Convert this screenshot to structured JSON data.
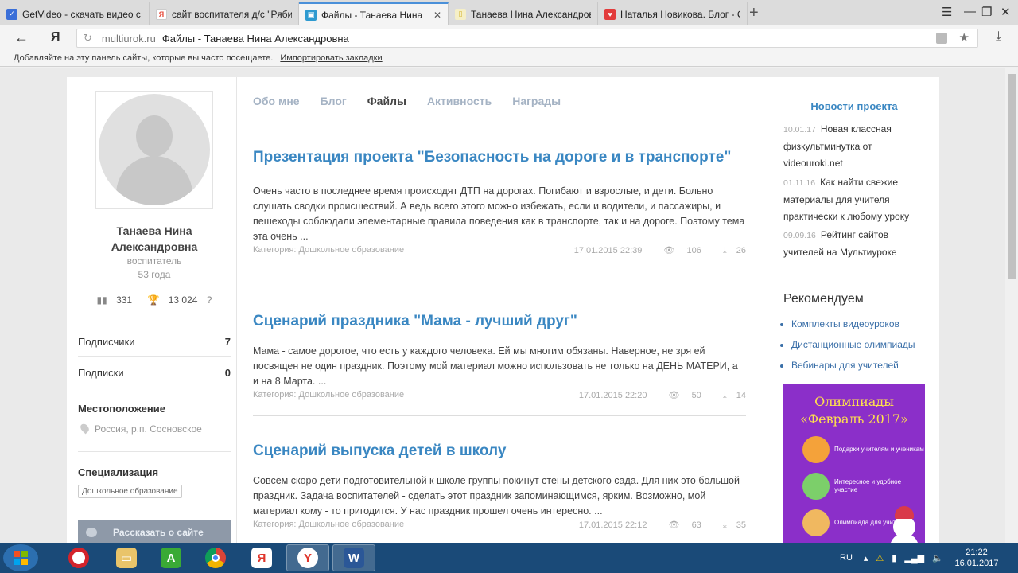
{
  "browser": {
    "tabs": [
      {
        "label": "GetVideo - скачать видео с",
        "icon": "getvideo-icon",
        "color": "#3a6fd8"
      },
      {
        "label": "сайт воспитателя д/с \"Рябин",
        "icon": "yandex-icon",
        "color": "#e74c3c"
      },
      {
        "label": "Файлы - Танаева Нина А",
        "icon": "multiurok-icon",
        "color": "#2e9ad0",
        "active": true
      },
      {
        "label": "Танаева Нина Александров",
        "icon": "page-icon",
        "color": "#e8d65a"
      },
      {
        "label": "Наталья Новикова. Блог - С",
        "icon": "blog-icon",
        "color": "#e23b3b"
      }
    ],
    "address": {
      "domain": "multiurok.ru",
      "title": "Файлы - Танаева Нина Александровна",
      "ya": "Я"
    },
    "bookmarks": {
      "hint": "Добавляйте на эту панель сайты, которые вы часто посещаете.",
      "import_link": "Импортировать закладки"
    }
  },
  "profile": {
    "name": "Танаева Нина Александровна",
    "role": "воспитатель",
    "age": "53 года",
    "rating": "331",
    "awards": "13 024",
    "subscribers_label": "Подписчики",
    "subscribers_count": "7",
    "subscriptions_label": "Подписки",
    "subscriptions_count": "0",
    "location_heading": "Местоположение",
    "location": "Россия, р.п. Сосновское",
    "spec_heading": "Специализация",
    "spec_tag": "Дошкольное образование",
    "share_label": "Рассказать о сайте"
  },
  "nav": {
    "about": "Обо мне",
    "blog": "Блог",
    "files": "Файлы",
    "activity": "Активность",
    "awards": "Награды"
  },
  "posts": [
    {
      "title": "Презентация проекта \"Безопасность на дороге и в транспорте\"",
      "text": "Очень часто в последнее время происходят ДТП на дорогах. Погибают и взрослые, и дети. Больно слушать сводки происшествий. А ведь всего этого можно избежать, если и водители, и пассажиры, и пешеходы соблюдали элементарные правила поведения как в транспорте, так и на дороге. Поэтому тема эта очень ...",
      "category": "Категория: Дошкольное образование",
      "date": "17.01.2015 22:39",
      "views": "106",
      "downloads": "26"
    },
    {
      "title": "Сценарий праздника \"Мама - лучший друг\"",
      "text": "Мама - самое дорогое, что есть у каждого человека. Ей мы многим обязаны. Наверное, не зря ей посвящен не один праздник. Поэтому мой материал можно использовать не только на ДЕНЬ МАТЕРИ, а и на 8 Марта. ...",
      "category": "Категория: Дошкольное образование",
      "date": "17.01.2015 22:20",
      "views": "50",
      "downloads": "14"
    },
    {
      "title": "Сценарий выпуска детей в школу",
      "text": "Совсем скоро дети подготовительной к школе группы покинут стены детского сада. Для них это большой праздник. Задача воспитателей - сделать этот праздник запоминающимся, ярким. Возможно, мой материал кому - то пригодится. У нас праздник прошел очень интересно. ...",
      "category": "Категория: Дошкольное образование",
      "date": "17.01.2015 22:12",
      "views": "63",
      "downloads": "35"
    }
  ],
  "sidebar": {
    "news_heading": "Новости проекта",
    "news": [
      {
        "date": "10.01.17",
        "text": "Новая классная физкультминутка от videouroki.net"
      },
      {
        "date": "01.11.16",
        "text": "Как найти свежие материалы для учителя практически к любому уроку"
      },
      {
        "date": "09.09.16",
        "text": "Рейтинг сайтов учителей на Мультиуроке"
      }
    ],
    "recommend_heading": "Рекомендуем",
    "recommend": [
      "Комплекты видеоуроков",
      "Дистанционные олимпиады",
      "Вебинары для учителей"
    ],
    "banner": {
      "title1": "Олимпиады",
      "title2": "«Февраль 2017»",
      "items": [
        "Подарки учителям и ученикам",
        "Интересное и удобное участие",
        "Олимпиада для учителей"
      ]
    }
  },
  "taskbar": {
    "lang": "RU",
    "time": "21:22",
    "date": "16.01.2017",
    "apps": [
      "opera-icon",
      "explorer-icon",
      "green-a-icon",
      "chrome-icon",
      "yandex-browser-icon",
      "yandex-y-icon",
      "word-icon"
    ]
  }
}
